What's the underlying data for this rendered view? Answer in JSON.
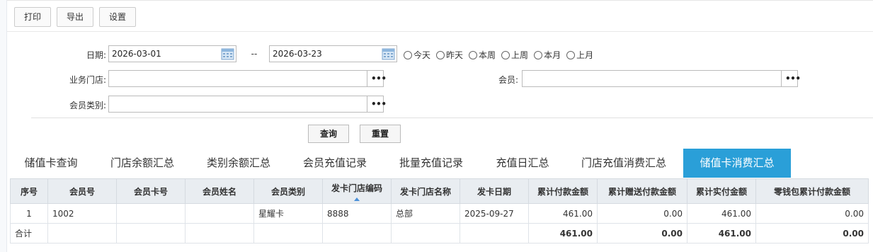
{
  "toolbar": {
    "print": "打印",
    "export": "导出",
    "settings": "设置"
  },
  "filters": {
    "date_label": "日期:",
    "date_from": "2026-03-01",
    "date_sep": "--",
    "date_to": "2026-03-23",
    "quick_ranges": [
      "今天",
      "昨天",
      "本周",
      "上周",
      "本月",
      "上月"
    ],
    "store_label": "业务门店:",
    "member_label": "会员:",
    "member_type_label": "会员类别:"
  },
  "actions": {
    "query": "查询",
    "reset": "重置"
  },
  "tabs": [
    {
      "label": "储值卡查询"
    },
    {
      "label": "门店余额汇总"
    },
    {
      "label": "类别余额汇总"
    },
    {
      "label": "会员充值记录"
    },
    {
      "label": "批量充值记录"
    },
    {
      "label": "充值日汇总"
    },
    {
      "label": "门店充值消费汇总"
    },
    {
      "label": "储值卡消费汇总"
    }
  ],
  "active_tab": "储值卡消费汇总",
  "table": {
    "headers": [
      "序号",
      "会员号",
      "会员卡号",
      "会员姓名",
      "会员类别",
      "发卡门店编码",
      "发卡门店名称",
      "发卡日期",
      "累计付款金额",
      "累计赠送付款金额",
      "累计实付金额",
      "零钱包累计付款金额"
    ],
    "rows": [
      [
        "1",
        "1002",
        "",
        "",
        "星耀卡",
        "8888",
        "总部",
        "2025-09-27",
        "461.00",
        "0.00",
        "461.00",
        "0.00"
      ]
    ],
    "total": [
      "合计",
      "",
      "",
      "",
      "",
      "",
      "",
      "",
      "461.00",
      "0.00",
      "461.00",
      "0.00"
    ]
  },
  "colors": {
    "active_tab": "#2a9fd8",
    "header_bg": "#e9edf1",
    "sort_arrow": "#4a90d9"
  }
}
